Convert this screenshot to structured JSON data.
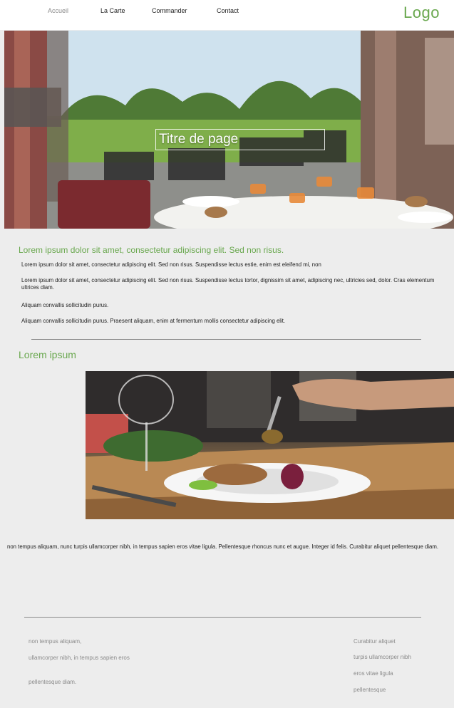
{
  "nav": {
    "items": [
      {
        "label": "Accueil",
        "active": true
      },
      {
        "label": "La Carte",
        "active": false
      },
      {
        "label": "Commander",
        "active": false
      },
      {
        "label": "Contact",
        "active": false
      }
    ],
    "logo": "Logo"
  },
  "hero": {
    "title": "Titre de page"
  },
  "intro": {
    "heading": "Lorem ipsum dolor sit amet, consectetur adipiscing elit. Sed non risus.",
    "paragraphs": [
      "Lorem ipsum dolor sit amet, consectetur adipiscing elit. Sed non risus. Suspendisse lectus estie, enim est eleifend mi, non",
      "Lorem ipsum dolor sit amet, consectetur adipiscing elit. Sed non risus. Suspendisse lectus tortor, dignissim sit amet, adipiscing nec, ultricies sed, dolor. Cras elementum ultrices diam.",
      "Aliquam convallis sollicitudin purus.",
      "Aliquam convallis sollicitudin purus. Praesent aliquam, enim at fermentum mollis  consectetur adipiscing elit."
    ]
  },
  "section2": {
    "heading": "Lorem ipsum",
    "body": "non tempus aliquam, nunc turpis ullamcorper nibh, in tempus sapien eros vitae ligula. Pellentesque rhoncus nunc et augue. Integer id felis. Curabitur aliquet pellentesque diam."
  },
  "footer": {
    "left": [
      "non tempus aliquam,",
      "ullamcorper nibh, in tempus sapien eros",
      "pellentesque diam."
    ],
    "right": [
      "Curabitur aliquet",
      "turpis ullamcorper nibh",
      "eros vitae ligula",
      "pellentesque"
    ]
  },
  "colors": {
    "accent": "#6aa84f",
    "background": "#ededed",
    "header_bg": "#ffffff",
    "muted_text": "#8a8a8a"
  }
}
